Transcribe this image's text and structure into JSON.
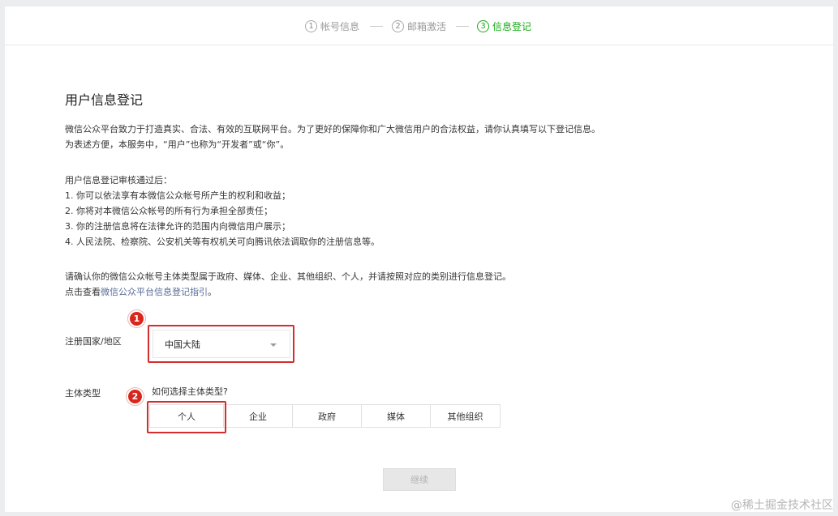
{
  "steps": [
    {
      "num": "1",
      "label": "帐号信息",
      "active": false
    },
    {
      "num": "2",
      "label": "邮箱激活",
      "active": false
    },
    {
      "num": "3",
      "label": "信息登记",
      "active": true
    }
  ],
  "page_title": "用户信息登记",
  "intro": {
    "line1": "微信公众平台致力于打造真实、合法、有效的互联网平台。为了更好的保障你和广大微信用户的合法权益，请你认真填写以下登记信息。",
    "line2": "为表述方便，本服务中，“用户”也称为“开发者”或“你”。"
  },
  "review": {
    "heading": "用户信息登记审核通过后：",
    "items": [
      "1. 你可以依法享有本微信公众帐号所产生的权利和收益；",
      "2. 你将对本微信公众帐号的所有行为承担全部责任；",
      "3. 你的注册信息将在法律允许的范围内向微信用户展示；",
      "4. 人民法院、检察院、公安机关等有权机关可向腾讯依法调取你的注册信息等。"
    ]
  },
  "confirm": {
    "line1": "请确认你的微信公众帐号主体类型属于政府、媒体、企业、其他组织、个人，并请按照对应的类别进行信息登记。",
    "line2_prefix": "点击查看",
    "line2_link": "微信公众平台信息登记指引",
    "line2_suffix": "。"
  },
  "region": {
    "label": "注册国家/地区",
    "selected": "中国大陆"
  },
  "subject": {
    "label": "主体类型",
    "help_link": "如何选择主体类型?",
    "options": [
      "个人",
      "企业",
      "政府",
      "媒体",
      "其他组织"
    ],
    "selected_index": 0
  },
  "annotations": {
    "badge1": "1",
    "badge2": "2"
  },
  "continue_label": "继续",
  "watermark": "@稀土掘金技术社区",
  "colors": {
    "active_step": "#1aad19",
    "link": "#576b95",
    "annotation_red": "#d42d2d"
  }
}
